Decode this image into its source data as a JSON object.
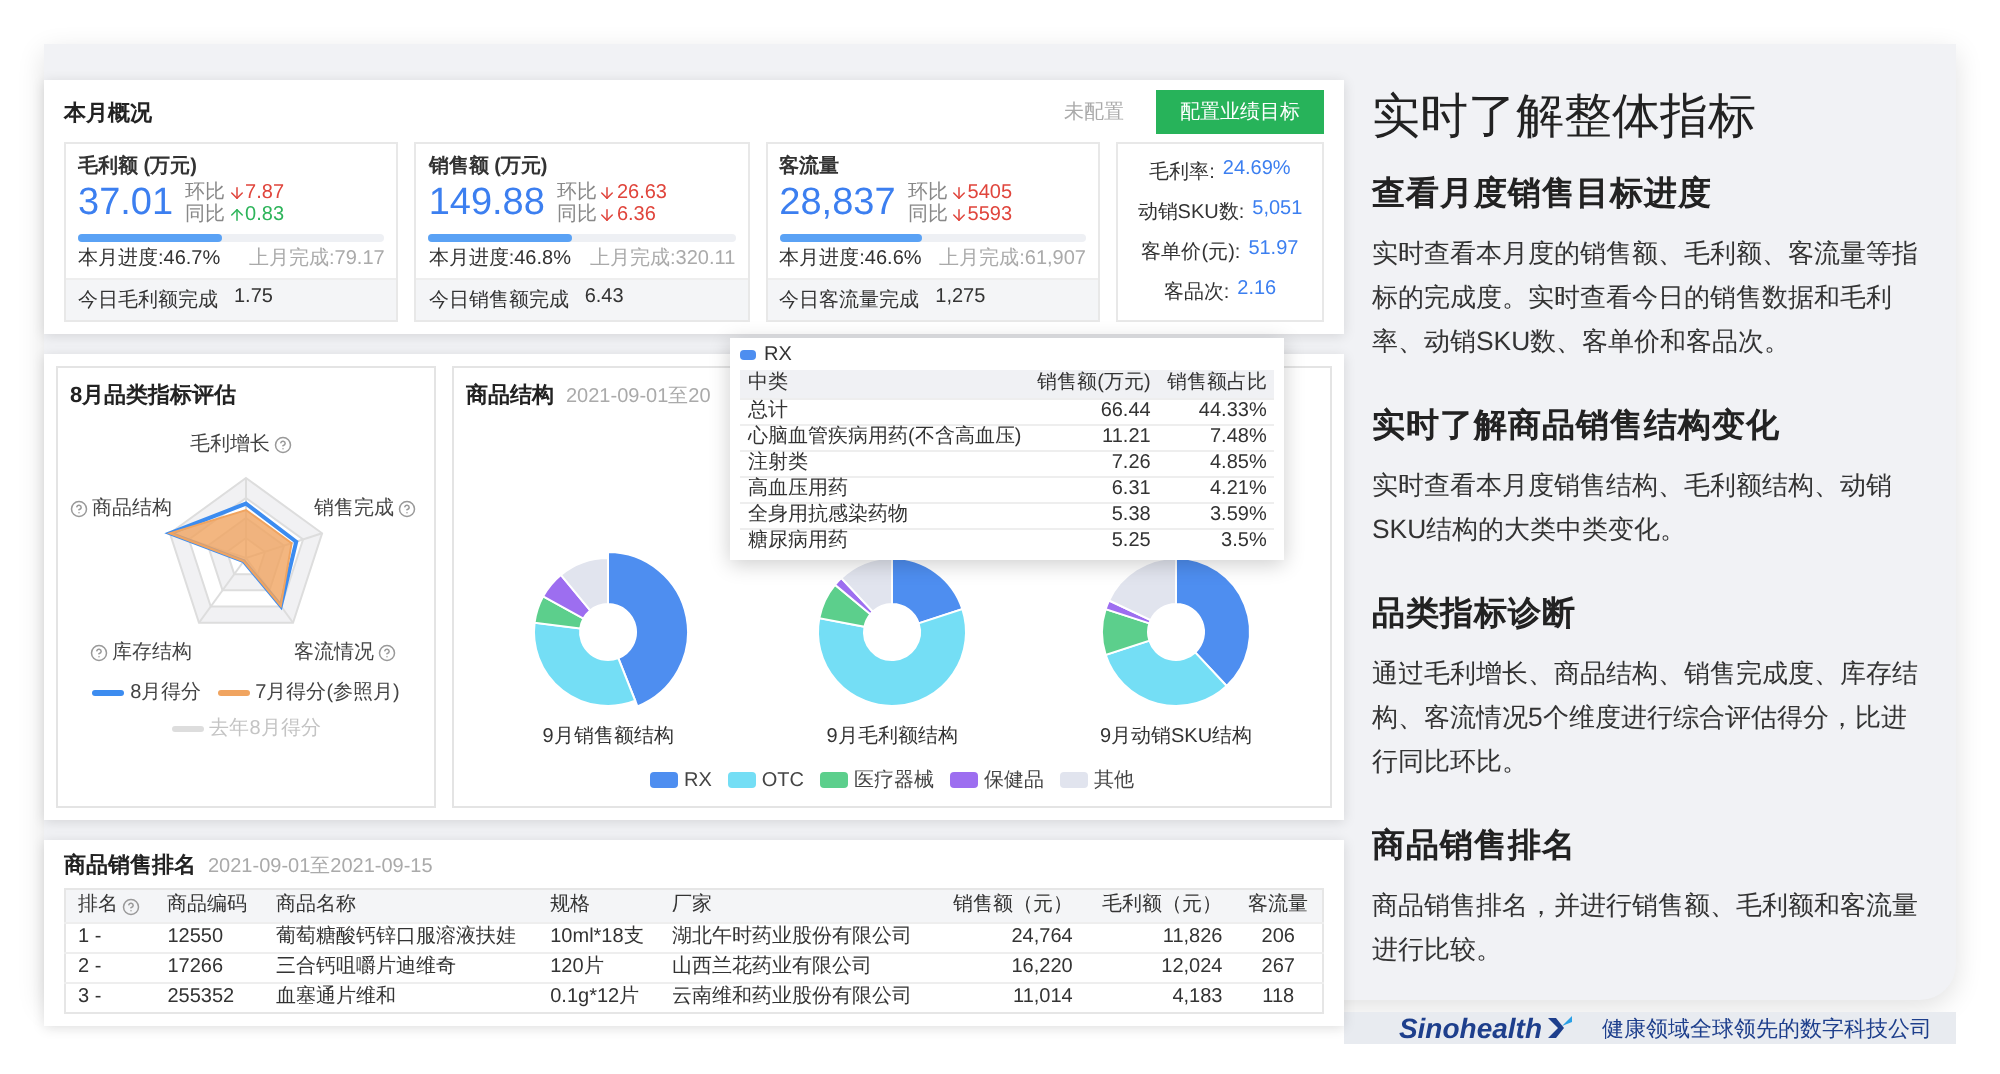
{
  "overview": {
    "title": "本月概况",
    "status": "未配置",
    "button": "配置业绩目标",
    "cards": [
      {
        "title": "毛利额 (万元)",
        "value": "37.01",
        "changes": [
          {
            "label": "环比",
            "increase": false,
            "value": "7.87"
          },
          {
            "label": "同比",
            "increase": true,
            "value": "0.83"
          }
        ],
        "level": 0.467,
        "progress": "本月进度:46.7%",
        "last_month": "上月完成:79.17",
        "today_label": "今日毛利额完成",
        "today_value": "1.75"
      },
      {
        "title": "销售额 (万元)",
        "value": "149.88",
        "changes": [
          {
            "label": "环比",
            "increase": false,
            "value": "26.63"
          },
          {
            "label": "同比",
            "increase": false,
            "value": "6.36"
          }
        ],
        "level": 0.468,
        "progress": "本月进度:46.8%",
        "last_month": "上月完成:320.11",
        "today_label": "今日销售额完成",
        "today_value": "6.43"
      },
      {
        "title": "客流量",
        "value": "28,837",
        "changes": [
          {
            "label": "环比",
            "increase": false,
            "value": "5405"
          },
          {
            "label": "同比",
            "increase": false,
            "value": "5593"
          }
        ],
        "level": 0.466,
        "progress": "本月进度:46.6%",
        "last_month": "上月完成:61,907",
        "today_label": "今日客流量完成",
        "today_value": "1,275"
      }
    ],
    "ratios": [
      {
        "label": "毛利率:",
        "value": "24.69%"
      },
      {
        "label": "动销SKU数:",
        "value": "5,051"
      },
      {
        "label": "客单价(元):",
        "value": "51.97"
      },
      {
        "label": "客品次:",
        "value": "2.16"
      }
    ]
  },
  "category_eval": {
    "title": "8月品类指标评估",
    "axes": [
      "毛利增长",
      "销售完成",
      "客流情况",
      "库存结构",
      "商品结构"
    ],
    "legend": [
      {
        "label": "8月得分",
        "color": "#3c8cf0",
        "disabled": false
      },
      {
        "label": "7月得分(参照月)",
        "color": "#f0a460",
        "disabled": false
      },
      {
        "label": "去年8月得分",
        "color": "#cfcfcf",
        "disabled": true
      }
    ]
  },
  "structure": {
    "title": "商品结构",
    "date": "2021-09-01至20",
    "captions": [
      "9月销售额结构",
      "9月毛利额结构",
      "9月动销SKU结构"
    ],
    "legend": [
      {
        "label": "RX",
        "color": "#4e8ef0"
      },
      {
        "label": "OTC",
        "color": "#74def5"
      },
      {
        "label": "医疗器械",
        "color": "#5ccf8c"
      },
      {
        "label": "保健品",
        "color": "#9d6ef0"
      },
      {
        "label": "其他",
        "color": "#e1e4ee"
      }
    ],
    "tooltip": {
      "series": "RX",
      "columns": [
        "中类",
        "销售额(万元)",
        "销售额占比"
      ],
      "rows": [
        [
          "总计",
          "66.44",
          "44.33%"
        ],
        [
          "心脑血管疾病用药(不含高血压)",
          "11.21",
          "7.48%"
        ],
        [
          "注射类",
          "7.26",
          "4.85%"
        ],
        [
          "高血压用药",
          "6.31",
          "4.21%"
        ],
        [
          "全身用抗感染药物",
          "5.38",
          "3.59%"
        ],
        [
          "糖尿病用药",
          "5.25",
          "3.5%"
        ]
      ]
    }
  },
  "ranking": {
    "title": "商品销售排名",
    "date": "2021-09-01至2021-09-15",
    "columns": [
      "排名",
      "商品编码",
      "商品名称",
      "规格",
      "厂家",
      "销售额（元）",
      "毛利额（元）",
      "客流量"
    ],
    "rows": [
      [
        "1 -",
        "12550",
        "葡萄糖酸钙锌口服溶液扶娃",
        "10ml*18支",
        "湖北午时药业股份有限公司",
        "24,764",
        "11,826",
        "206"
      ],
      [
        "2 -",
        "17266",
        "三合钙咀嚼片迪维奇",
        "120片",
        "山西兰花药业有限公司",
        "16,220",
        "12,024",
        "267"
      ],
      [
        "3 -",
        "255352",
        "血塞通片维和",
        "0.1g*12片",
        "云南维和药业股份有限公司",
        "11,014",
        "4,183",
        "118"
      ]
    ]
  },
  "features": {
    "headline": "实时了解整体指标",
    "sections": [
      {
        "heading": "查看月度销售目标进度",
        "text": "实时查看本月度的销售额、毛利额、客流量等指标的完成度。实时查看今日的销售数据和毛利率、动销SKU数、客单价和客品次。"
      },
      {
        "heading": "实时了解商品销售结构变化",
        "text": "实时查看本月度销售结构、毛利额结构、动销SKU结构的大类中类变化。"
      },
      {
        "heading": "品类指标诊断",
        "text": "通过毛利增长、商品结构、销售完成度、库存结构、客流情况5个维度进行综合评估得分，比进行同比环比。"
      },
      {
        "heading": "商品销售排名",
        "text": "商品销售排名，并进行销售额、毛利额和客流量进行比较。"
      }
    ]
  },
  "footer": {
    "brand": "Sinohealth",
    "slogan": "健康领域全球领先的数字科技公司"
  }
}
